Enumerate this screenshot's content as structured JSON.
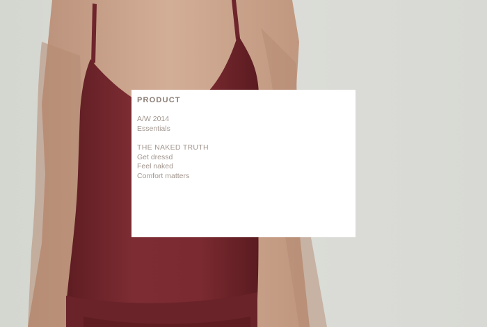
{
  "hero": {
    "image_icon": "model-in-burgundy-camisole-photo",
    "colors": {
      "background": "#d9dad5",
      "garment": "#7a2a30",
      "skin": "#caa48d",
      "panel": "#ffffff",
      "heading_text": "#8a7d75",
      "link_text": "#a2968f"
    }
  },
  "panel": {
    "heading": "PRODUCT",
    "season": {
      "title": "A/W 2014",
      "items": [
        "Essentials"
      ]
    },
    "campaign": {
      "title": "THE NAKED TRUTH",
      "items": [
        "Get dressd",
        "Feel naked",
        "Comfort matters"
      ]
    }
  }
}
